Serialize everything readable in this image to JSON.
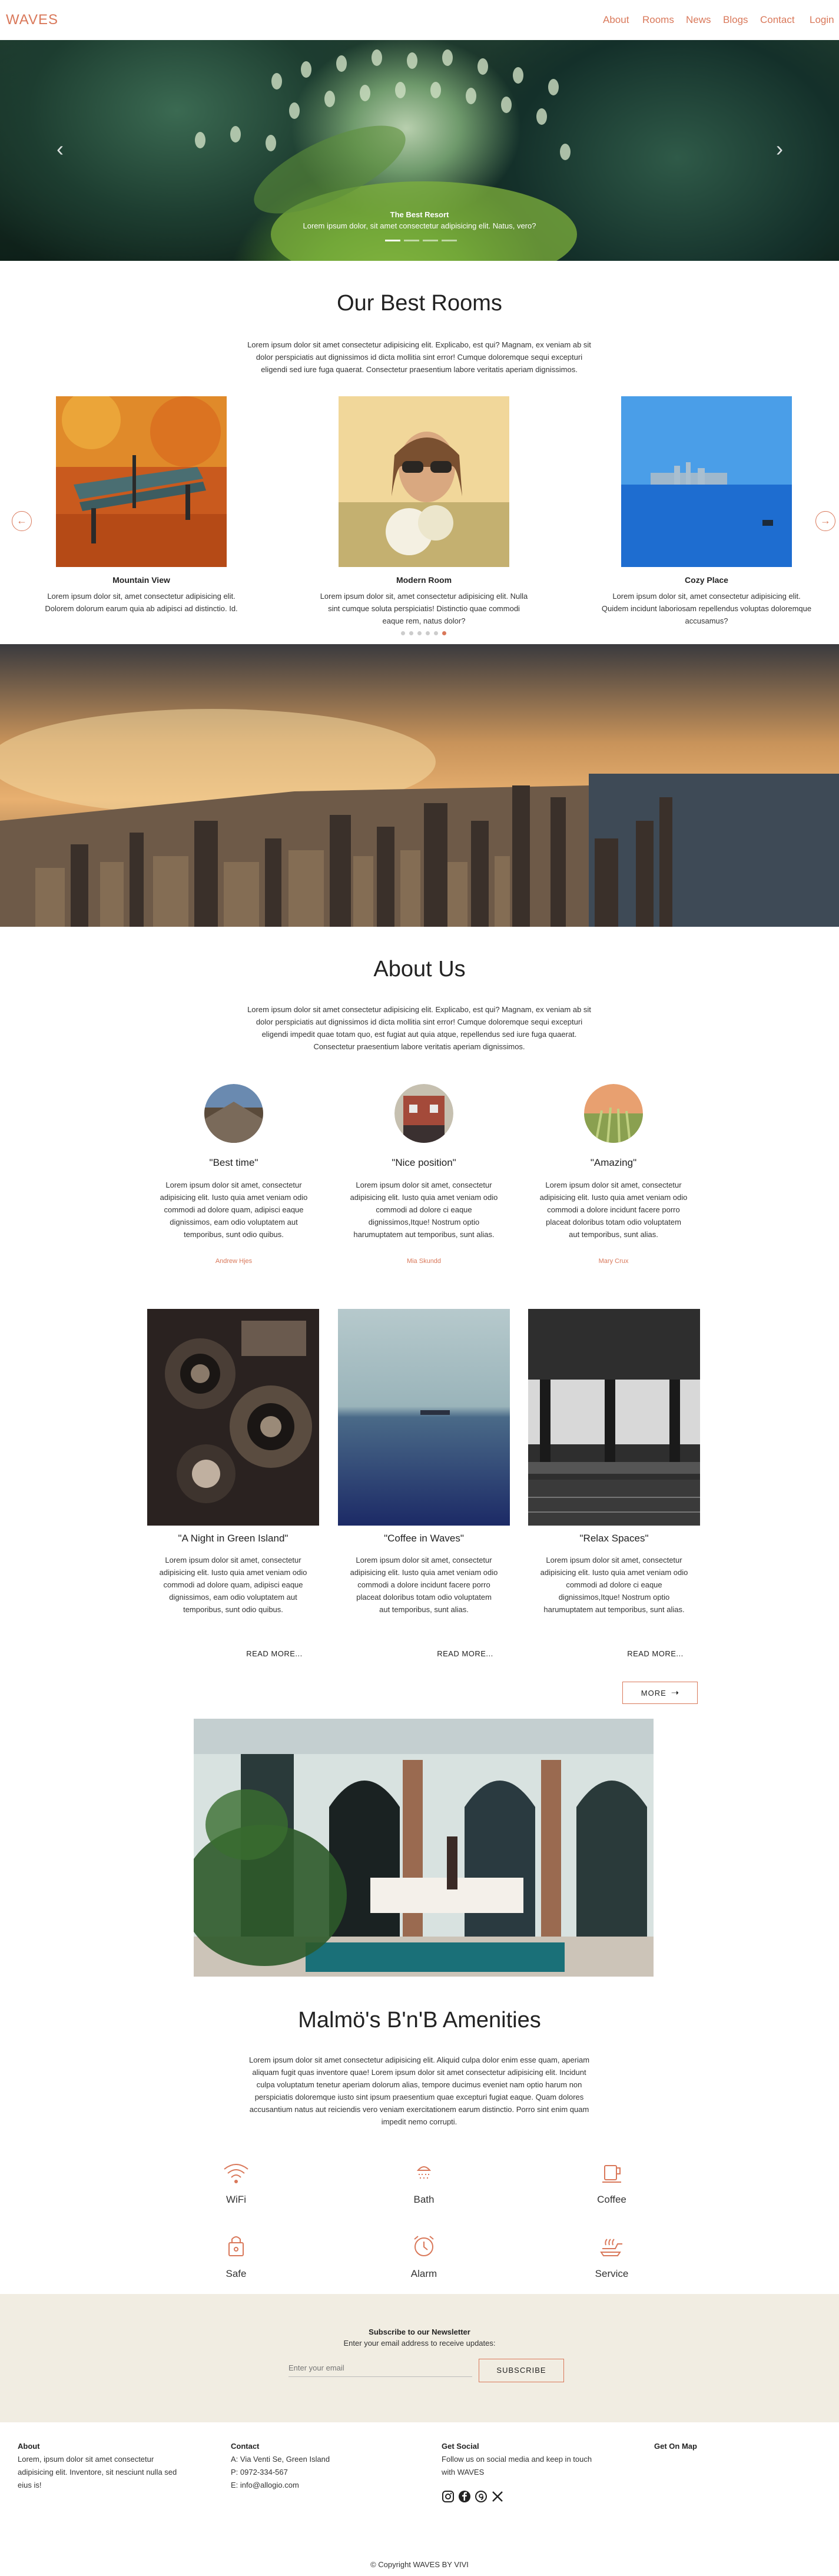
{
  "header": {
    "logo": "WAVES",
    "nav": [
      "About",
      "Rooms",
      "News",
      "Blogs",
      "Contact",
      "Login"
    ]
  },
  "hero": {
    "title": "The Best Resort",
    "subtitle": "Lorem ipsum dolor, sit amet consectetur adipisicing elit. Natus, vero?",
    "prev_icon": "chevron-left-icon",
    "next_icon": "chevron-right-icon"
  },
  "rooms": {
    "title": "Our Best Rooms",
    "intro": [
      "Lorem ipsum dolor sit amet consectetur adipisicing elit. Explicabo, est qui? Magnam, ex veniam ab sit",
      "dolor perspiciatis aut dignissimos id dicta mollitia sint error! Cumque doloremque sequi excepturi",
      "eligendi sed iure fuga quaerat. Consectetur praesentium labore veritatis aperiam dignissimos."
    ],
    "cards": [
      {
        "title": "Mountain View",
        "text": [
          "Lorem ipsum dolor sit, amet consectetur adipisicing elit.",
          "Dolorem dolorum earum quia ab adipisci ad distinctio. Id."
        ]
      },
      {
        "title": "Modern Room",
        "text": [
          "Lorem ipsum dolor sit, amet consectetur adipisicing elit. Nulla",
          "sint cumque soluta perspiciatis! Distinctio quae commodi",
          "eaque rem, natus dolor?"
        ]
      },
      {
        "title": "Cozy Place",
        "text": [
          "Lorem ipsum dolor sit, amet consectetur adipisicing elit.",
          "Quidem incidunt laboriosam repellendus voluptas doloremque",
          "accusamus?"
        ]
      }
    ]
  },
  "about": {
    "title": "About Us",
    "intro": [
      "Lorem ipsum dolor sit amet consectetur adipisicing elit. Explicabo, est qui? Magnam, ex veniam ab sit",
      "dolor perspiciatis aut dignissimos id dicta mollitia sint error! Cumque doloremque sequi excepturi",
      "eligendi impedit quae totam quo, est fugiat aut quia atque, repellendus sed iure fuga quaerat.",
      "Consectetur praesentium labore veritatis aperiam dignissimos."
    ],
    "testimonials": [
      {
        "quote": "\"Best time\"",
        "text": [
          "Lorem ipsum dolor sit amet, consectetur",
          "adipisicing elit. Iusto quia amet veniam odio",
          "commodi ad dolore quam, adipisci eaque",
          "dignissimos, eam odio voluptatem aut",
          "temporibus, sunt odio quibus."
        ],
        "author": "Andrew Hjes"
      },
      {
        "quote": "\"Nice position\"",
        "text": [
          "Lorem ipsum dolor sit amet, consectetur",
          "adipisicing elit. Iusto quia amet veniam odio",
          "commodi ad dolore ci eaque",
          "dignissimos,Itque! Nostrum optio",
          "harumuptatem aut temporibus, sunt alias."
        ],
        "author": "Mia Skundd"
      },
      {
        "quote": "\"Amazing\"",
        "text": [
          "Lorem ipsum dolor sit amet, consectetur",
          "adipisicing elit. Iusto quia amet veniam odio",
          "commodi a dolore incidunt facere porro",
          "placeat doloribus totam odio voluptatem",
          "aut temporibus, sunt alias."
        ],
        "author": "Mary Crux"
      }
    ]
  },
  "blog": {
    "posts": [
      {
        "title": "\"A Night in Green Island\"",
        "text": [
          "Lorem ipsum dolor sit amet, consectetur",
          "adipisicing elit. Iusto quia amet veniam odio",
          "commodi ad dolore quam, adipisci eaque",
          "dignissimos, eam odio voluptatem aut",
          "temporibus, sunt odio quibus."
        ],
        "read": "READ MORE..."
      },
      {
        "title": "\"Coffee in Waves\"",
        "text": [
          "Lorem ipsum dolor sit amet, consectetur",
          "adipisicing elit. Iusto quia amet veniam odio",
          "commodi a dolore incidunt facere porro",
          "placeat doloribus totam odio voluptatem",
          "aut temporibus, sunt alias."
        ],
        "read": "READ MORE..."
      },
      {
        "title": "\"Relax Spaces\"",
        "text": [
          "Lorem ipsum dolor sit amet, consectetur",
          "adipisicing elit. Iusto quia amet veniam odio",
          "commodi ad dolore ci eaque",
          "dignissimos,Itque! Nostrum optio",
          "harumuptatem aut temporibus, sunt alias."
        ],
        "read": "READ MORE..."
      }
    ],
    "more": "MORE"
  },
  "amenities": {
    "title": "Malmö's B'n'B Amenities",
    "intro": [
      "Lorem ipsum dolor sit amet consectetur adipisicing elit. Aliquid culpa dolor enim esse quam, aperiam",
      "aliquam fugit quas inventore quae! Lorem ipsum dolor sit amet consectetur adipisicing elit. Incidunt",
      "culpa voluptatum tenetur aperiam dolorum alias, tempore ducimus eveniet nam optio harum non",
      "perspiciatis doloremque iusto sint ipsum praesentium quae excepturi fugiat eaque. Quam dolores",
      "accusantium natus aut reiciendis vero veniam exercitationem earum distinctio. Porro sint enim quam",
      "impedit nemo corrupti."
    ],
    "items": [
      {
        "label": "WiFi",
        "icon": "wifi-icon"
      },
      {
        "label": "Bath",
        "icon": "bath-icon"
      },
      {
        "label": "Coffee",
        "icon": "coffee-icon"
      },
      {
        "label": "Safe",
        "icon": "safe-icon"
      },
      {
        "label": "Alarm",
        "icon": "alarm-icon"
      },
      {
        "label": "Service",
        "icon": "service-icon"
      }
    ]
  },
  "newsletter": {
    "title": "Subscribe to our Newsletter",
    "subtitle": "Enter your email address to receive updates:",
    "placeholder": "Enter your email",
    "button": "SUBSCRIBE"
  },
  "footer": {
    "about_h": "About",
    "about_t": [
      "Lorem, ipsum dolor sit amet consectetur",
      "adipisicing elit. Inventore, sit nesciunt nulla sed",
      "eius is!"
    ],
    "contact_h": "Contact",
    "contact_t": [
      "A: Via Venti Se, Green Island",
      "P: 0972-334-567",
      "E: info@allogio.com"
    ],
    "social_h": "Get Social",
    "social_t": [
      "Follow us on social media and keep in touch",
      "with WAVES"
    ],
    "map_h": "Get On Map",
    "copyright": "© Copyright WAVES BY VIVI"
  },
  "colors": {
    "accent": "#d9785a",
    "newsletter_bg": "#f1ede2"
  }
}
